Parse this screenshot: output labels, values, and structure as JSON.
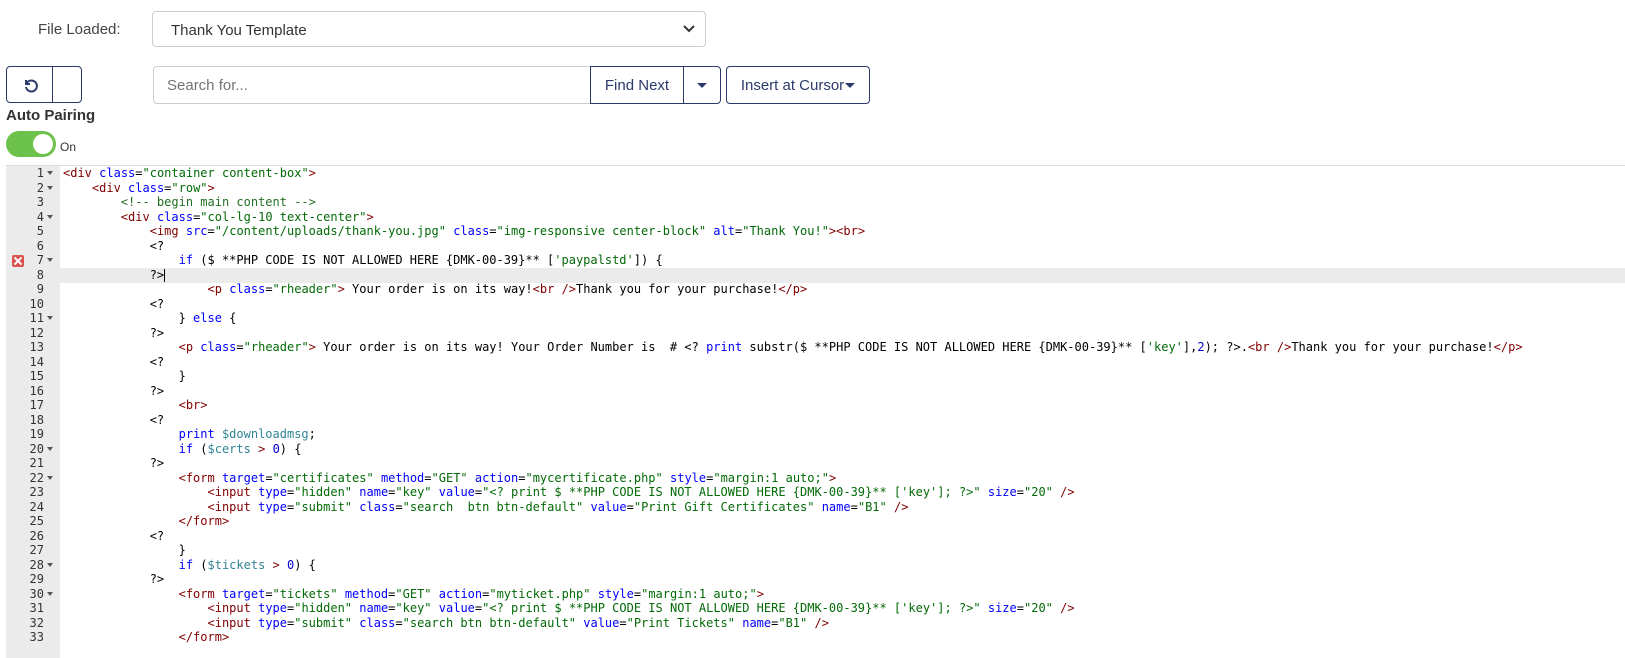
{
  "file_loaded": {
    "label": "File Loaded:",
    "selected": "Thank You Template"
  },
  "toolbar": {
    "undo_icon": "undo-icon",
    "search_placeholder": "Search for...",
    "find_next_label": "Find Next",
    "insert_label": "Insert at Cursor"
  },
  "auto_pairing": {
    "label": "Auto Pairing",
    "state": "On",
    "toggle_color": "#6cc24a"
  },
  "editor": {
    "active_line": 8,
    "error_line": 7,
    "lines": [
      {
        "n": "1",
        "fold": true,
        "text": "<div class=\"container content-box\">"
      },
      {
        "n": "2",
        "fold": true,
        "text": "    <div class=\"row\">"
      },
      {
        "n": "3",
        "fold": false,
        "text": "        <!-- begin main content -->"
      },
      {
        "n": "4",
        "fold": true,
        "text": "        <div class=\"col-lg-10 text-center\">"
      },
      {
        "n": "5",
        "fold": false,
        "text": "            <img src=\"/content/uploads/thank-you.jpg\" class=\"img-responsive center-block\" alt=\"Thank You!\"><br>"
      },
      {
        "n": "6",
        "fold": false,
        "text": "            <?"
      },
      {
        "n": "7",
        "fold": true,
        "text": "                if ($ **PHP CODE IS NOT ALLOWED HERE {DMK-00-39}** ['paypalstd']) {"
      },
      {
        "n": "8",
        "fold": false,
        "text": "            ?>"
      },
      {
        "n": "9",
        "fold": false,
        "text": "                    <p class=\"rheader\"> Your order is on its way!<br />Thank you for your purchase!</p>"
      },
      {
        "n": "10",
        "fold": false,
        "text": "            <?"
      },
      {
        "n": "11",
        "fold": true,
        "text": "                } else {"
      },
      {
        "n": "12",
        "fold": false,
        "text": "            ?>"
      },
      {
        "n": "13",
        "fold": false,
        "text": "                <p class=\"rheader\"> Your order is on its way! Your Order Number is  # <? print substr($ **PHP CODE IS NOT ALLOWED HERE {DMK-00-39}** ['key'],2); ?>.<br />Thank you for your purchase!</p>"
      },
      {
        "n": "14",
        "fold": false,
        "text": "            <?"
      },
      {
        "n": "15",
        "fold": false,
        "text": "                }"
      },
      {
        "n": "16",
        "fold": false,
        "text": "            ?>"
      },
      {
        "n": "17",
        "fold": false,
        "text": "                <br>"
      },
      {
        "n": "18",
        "fold": false,
        "text": "            <?"
      },
      {
        "n": "19",
        "fold": false,
        "text": "                print $downloadmsg;"
      },
      {
        "n": "20",
        "fold": true,
        "text": "                if ($certs > 0) {"
      },
      {
        "n": "21",
        "fold": false,
        "text": "            ?>"
      },
      {
        "n": "22",
        "fold": true,
        "text": "                <form target=\"certificates\" method=\"GET\" action=\"mycertificate.php\" style=\"margin:1 auto;\">"
      },
      {
        "n": "23",
        "fold": false,
        "text": "                    <input type=\"hidden\" name=\"key\" value=\"<? print $ **PHP CODE IS NOT ALLOWED HERE {DMK-00-39}** ['key']; ?>\" size=\"20\" />"
      },
      {
        "n": "24",
        "fold": false,
        "text": "                    <input type=\"submit\" class=\"search  btn btn-default\" value=\"Print Gift Certificates\" name=\"B1\" />"
      },
      {
        "n": "25",
        "fold": false,
        "text": "                </form>"
      },
      {
        "n": "26",
        "fold": false,
        "text": "            <?"
      },
      {
        "n": "27",
        "fold": false,
        "text": "                }"
      },
      {
        "n": "28",
        "fold": true,
        "text": "                if ($tickets > 0) {"
      },
      {
        "n": "29",
        "fold": false,
        "text": "            ?>"
      },
      {
        "n": "30",
        "fold": true,
        "text": "                <form target=\"tickets\" method=\"GET\" action=\"myticket.php\" style=\"margin:1 auto;\">"
      },
      {
        "n": "31",
        "fold": false,
        "text": "                    <input type=\"hidden\" name=\"key\" value=\"<? print $ **PHP CODE IS NOT ALLOWED HERE {DMK-00-39}** ['key']; ?>\" size=\"20\" />"
      },
      {
        "n": "32",
        "fold": false,
        "text": "                    <input type=\"submit\" class=\"search btn btn-default\" value=\"Print Tickets\" name=\"B1\" />"
      },
      {
        "n": "33",
        "fold": false,
        "text": "                </form>"
      }
    ]
  },
  "colors": {
    "tag": "#800000",
    "attr": "#0000ff",
    "string": "#036a07",
    "comment": "#236e24",
    "keyword": "#0000ff",
    "number": "#0000cd",
    "variable": "#318495"
  }
}
